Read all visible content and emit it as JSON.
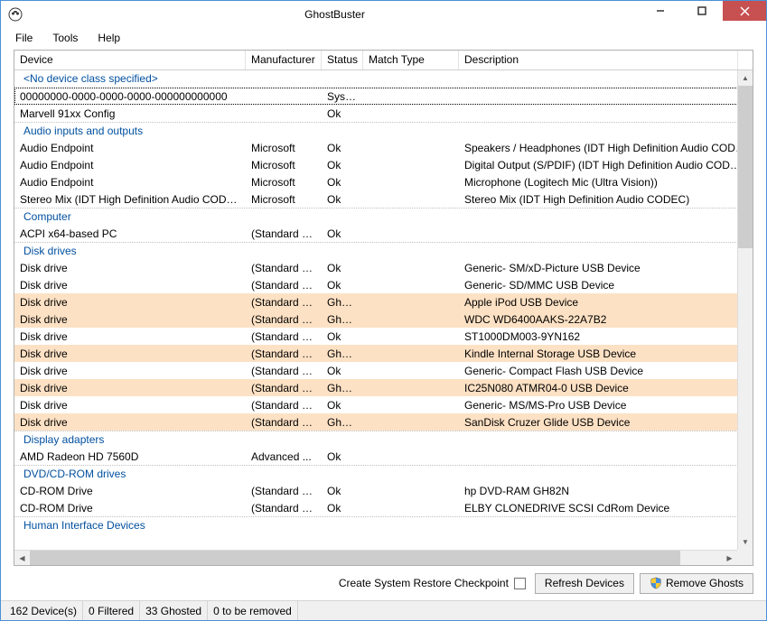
{
  "window": {
    "title": "GhostBuster"
  },
  "menu": {
    "file": "File",
    "tools": "Tools",
    "help": "Help"
  },
  "columns": {
    "device": "Device",
    "manufacturer": "Manufacturer",
    "status": "Status",
    "match_type": "Match Type",
    "description": "Description"
  },
  "groups": [
    {
      "label": "<No device class specified>",
      "rows": [
        {
          "device": "00000000-0000-0000-0000-000000000000",
          "mfr": "",
          "status": "System",
          "match": "",
          "desc": "",
          "selected": true
        },
        {
          "device": "Marvell 91xx Config",
          "mfr": "",
          "status": "Ok",
          "match": "",
          "desc": ""
        }
      ]
    },
    {
      "label": "Audio inputs and outputs",
      "rows": [
        {
          "device": "Audio Endpoint",
          "mfr": "Microsoft",
          "status": "Ok",
          "match": "",
          "desc": "Speakers / Headphones (IDT High Definition Audio CODEC)"
        },
        {
          "device": "Audio Endpoint",
          "mfr": "Microsoft",
          "status": "Ok",
          "match": "",
          "desc": "Digital Output (S/PDIF) (IDT High Definition Audio CODEC)"
        },
        {
          "device": "Audio Endpoint",
          "mfr": "Microsoft",
          "status": "Ok",
          "match": "",
          "desc": "Microphone (Logitech Mic (Ultra Vision))"
        },
        {
          "device": "Stereo Mix (IDT High Definition Audio CODEC)",
          "mfr": "Microsoft",
          "status": "Ok",
          "match": "",
          "desc": "Stereo Mix (IDT High Definition Audio CODEC)"
        }
      ]
    },
    {
      "label": "Computer",
      "rows": [
        {
          "device": "ACPI x64-based PC",
          "mfr": "(Standard c...",
          "status": "Ok",
          "match": "",
          "desc": ""
        }
      ]
    },
    {
      "label": "Disk drives",
      "rows": [
        {
          "device": "Disk drive",
          "mfr": "(Standard di...",
          "status": "Ok",
          "match": "",
          "desc": "Generic- SM/xD-Picture USB Device"
        },
        {
          "device": "Disk drive",
          "mfr": "(Standard di...",
          "status": "Ok",
          "match": "",
          "desc": "Generic- SD/MMC USB Device"
        },
        {
          "device": "Disk drive",
          "mfr": "(Standard di...",
          "status": "Ghosted",
          "match": "",
          "desc": "Apple iPod USB Device",
          "ghosted": true
        },
        {
          "device": "Disk drive",
          "mfr": "(Standard di...",
          "status": "Ghosted",
          "match": "",
          "desc": "WDC WD6400AAKS-22A7B2",
          "ghosted": true
        },
        {
          "device": "Disk drive",
          "mfr": "(Standard di...",
          "status": "Ok",
          "match": "",
          "desc": "ST1000DM003-9YN162"
        },
        {
          "device": "Disk drive",
          "mfr": "(Standard di...",
          "status": "Ghosted",
          "match": "",
          "desc": "Kindle Internal Storage USB Device",
          "ghosted": true
        },
        {
          "device": "Disk drive",
          "mfr": "(Standard di...",
          "status": "Ok",
          "match": "",
          "desc": "Generic- Compact Flash USB Device"
        },
        {
          "device": "Disk drive",
          "mfr": "(Standard di...",
          "status": "Ghosted",
          "match": "",
          "desc": "IC25N080 ATMR04-0 USB Device",
          "ghosted": true
        },
        {
          "device": "Disk drive",
          "mfr": "(Standard di...",
          "status": "Ok",
          "match": "",
          "desc": "Generic- MS/MS-Pro USB Device"
        },
        {
          "device": "Disk drive",
          "mfr": "(Standard di...",
          "status": "Ghosted",
          "match": "",
          "desc": "SanDisk Cruzer Glide USB Device",
          "ghosted": true
        }
      ]
    },
    {
      "label": "Display adapters",
      "rows": [
        {
          "device": "AMD Radeon HD 7560D",
          "mfr": "Advanced ...",
          "status": "Ok",
          "match": "",
          "desc": ""
        }
      ]
    },
    {
      "label": "DVD/CD-ROM drives",
      "rows": [
        {
          "device": "CD-ROM Drive",
          "mfr": "(Standard C...",
          "status": "Ok",
          "match": "",
          "desc": "hp DVD-RAM GH82N"
        },
        {
          "device": "CD-ROM Drive",
          "mfr": "(Standard C...",
          "status": "Ok",
          "match": "",
          "desc": "ELBY CLONEDRIVE SCSI CdRom Device"
        }
      ]
    },
    {
      "label": "Human Interface Devices",
      "rows": []
    }
  ],
  "actions": {
    "checkpoint_label": "Create System Restore Checkpoint",
    "refresh_label": "Refresh Devices",
    "remove_label": "Remove Ghosts"
  },
  "status": {
    "devices": "162 Device(s)",
    "filtered": "0 Filtered",
    "ghosted": "33 Ghosted",
    "toremove": "0 to be removed"
  }
}
